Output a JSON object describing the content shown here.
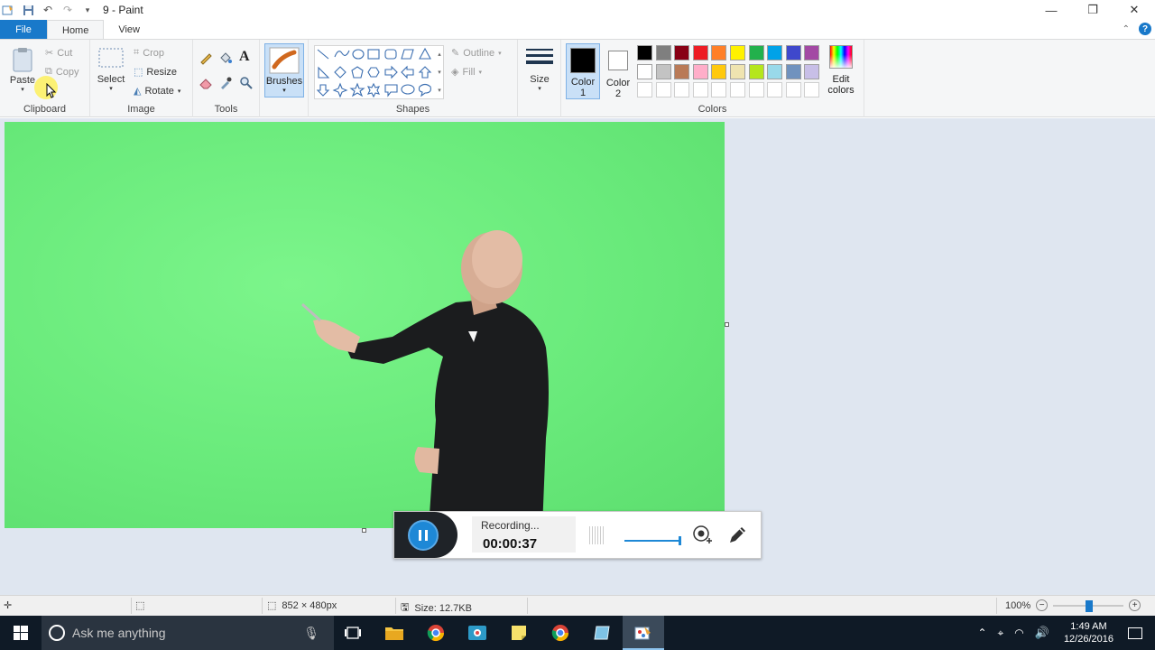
{
  "window": {
    "title": "9 - Paint",
    "controls": [
      "minimize",
      "restore",
      "close"
    ]
  },
  "ribbon_tabs": {
    "file": "File",
    "home": "Home",
    "view": "View"
  },
  "clipboard": {
    "paste": "Paste",
    "cut": "Cut",
    "copy": "Copy",
    "label": "Clipboard"
  },
  "image": {
    "select": "Select",
    "crop": "Crop",
    "resize": "Resize",
    "rotate": "Rotate",
    "label": "Image"
  },
  "tools": {
    "label": "Tools",
    "brushes": "Brushes"
  },
  "shapes": {
    "outline": "Outline",
    "fill": "Fill",
    "label": "Shapes"
  },
  "size": {
    "label": "Size"
  },
  "colors": {
    "color1": "Color",
    "color1_num": "1",
    "color2": "Color",
    "color2_num": "2",
    "edit": "Edit",
    "edit2": "colors",
    "label": "Colors",
    "color1_value": "#000000",
    "color2_value": "#ffffff",
    "palette_row1": [
      "#000000",
      "#7f7f7f",
      "#880015",
      "#ed1c24",
      "#ff7f27",
      "#fff200",
      "#22b14c",
      "#00a2e8",
      "#3f48cc",
      "#a349a4"
    ],
    "palette_row2": [
      "#ffffff",
      "#c3c3c3",
      "#b97a57",
      "#ffaec9",
      "#ffc90e",
      "#efe4b0",
      "#b5e61d",
      "#99d9ea",
      "#7092be",
      "#c8bfe7"
    ]
  },
  "recorder": {
    "status": "Recording...",
    "time": "00:00:37"
  },
  "statusbar": {
    "dimensions": "852 × 480px",
    "size": "Size: 12.7KB",
    "zoom": "100%"
  },
  "taskbar": {
    "search_placeholder": "Ask me anything",
    "time": "1:49 AM",
    "date": "12/26/2016"
  }
}
